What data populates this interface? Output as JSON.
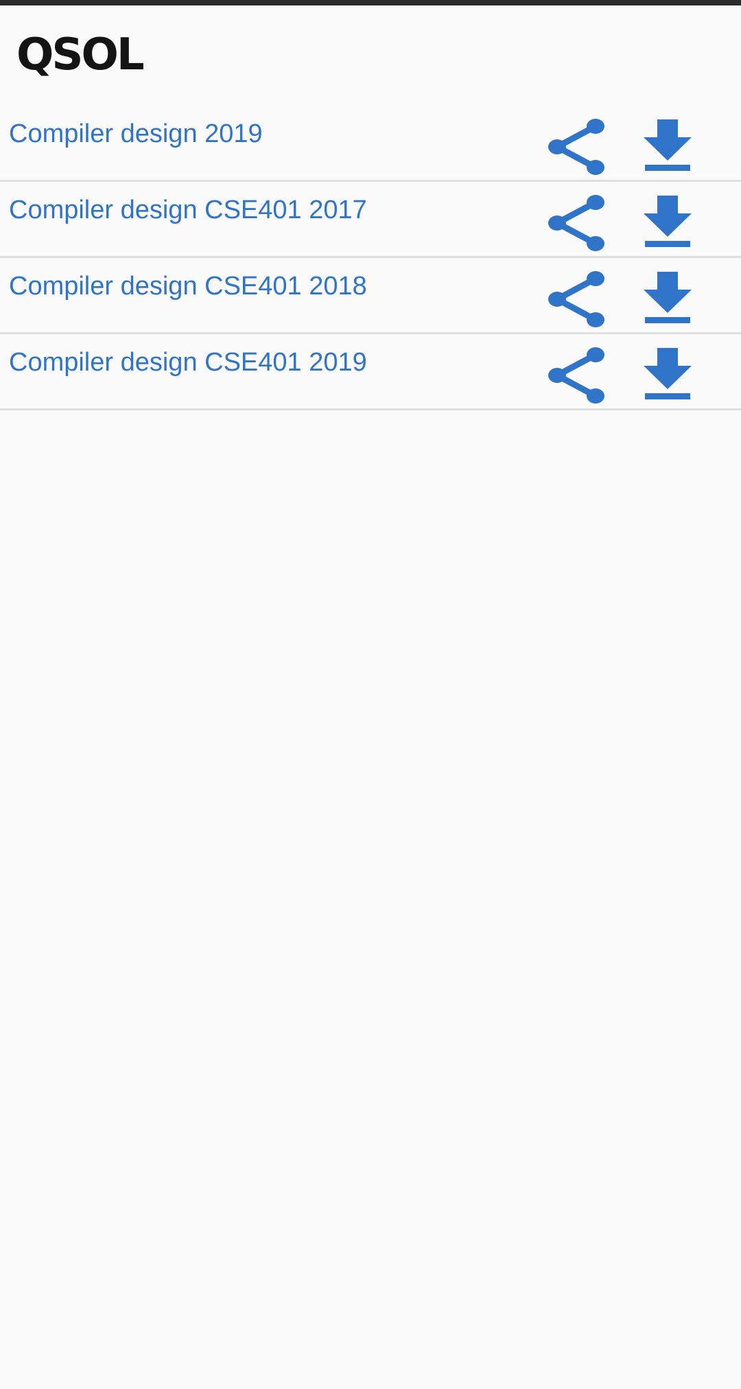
{
  "app": {
    "logo_text": "QSOL"
  },
  "files": [
    {
      "title": "Compiler design 2019"
    },
    {
      "title": "Compiler design CSE401 2017"
    },
    {
      "title": "Compiler design CSE401 2018"
    },
    {
      "title": "Compiler design CSE401 2019"
    }
  ],
  "icons": {
    "share": "share-icon",
    "download": "download-icon"
  },
  "colors": {
    "accent": "#2f74c8",
    "background": "#fafafa",
    "divider": "#dedede",
    "logo": "#141414"
  }
}
